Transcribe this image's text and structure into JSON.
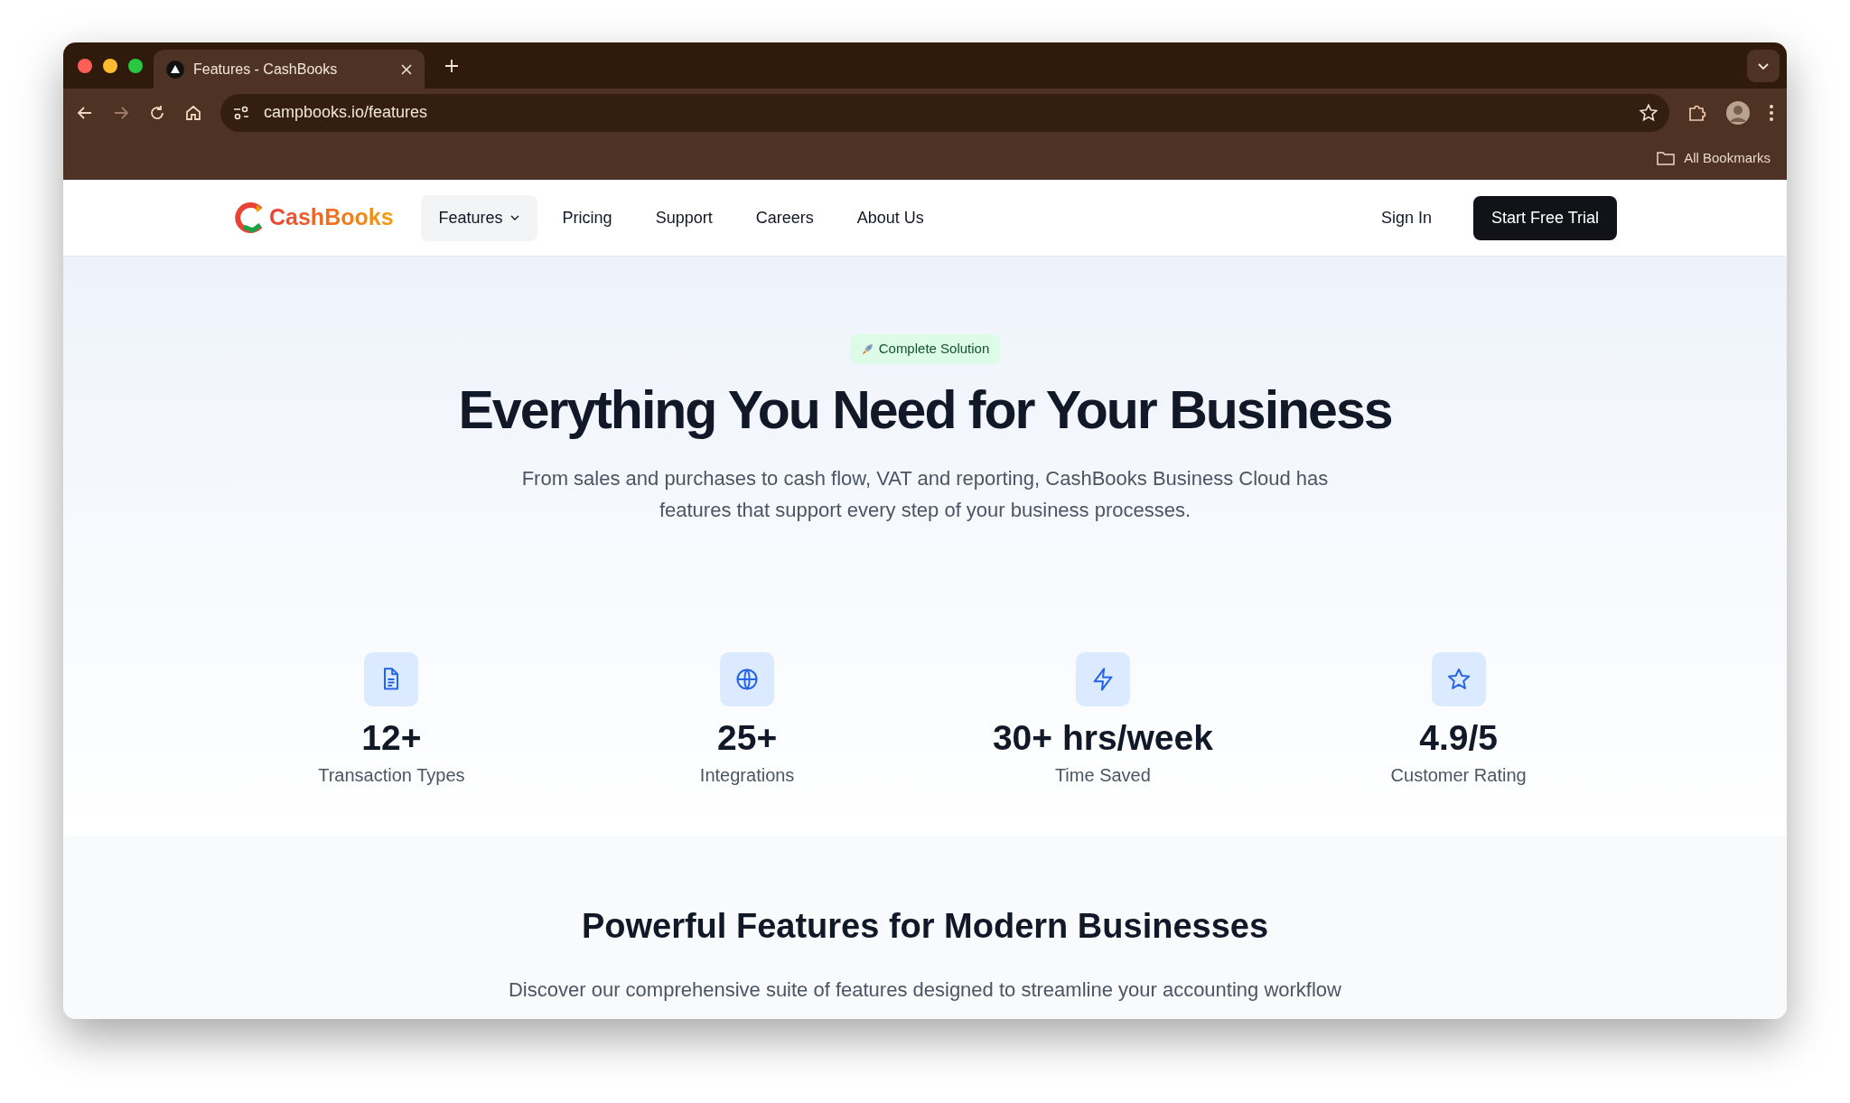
{
  "browser": {
    "tab_title": "Features - CashBooks",
    "address": "campbooks.io/features",
    "bookmarks_label": "All Bookmarks"
  },
  "navbar": {
    "logo_text": "CashBooks",
    "items": [
      {
        "label": "Features",
        "selected": true,
        "dropdown": true
      },
      {
        "label": "Pricing",
        "selected": false,
        "dropdown": false
      },
      {
        "label": "Support",
        "selected": false,
        "dropdown": false
      },
      {
        "label": "Careers",
        "selected": false,
        "dropdown": false
      },
      {
        "label": "About Us",
        "selected": false,
        "dropdown": false
      }
    ],
    "sign_in": "Sign In",
    "cta": "Start Free Trial"
  },
  "hero": {
    "badge": "Complete Solution",
    "title": "Everything You Need for Your Business",
    "subtitle": "From sales and purchases to cash flow, VAT and reporting, CashBooks Business Cloud has features that support every step of your business processes."
  },
  "stats": [
    {
      "kind": "document",
      "value": "12+",
      "label": "Transaction Types"
    },
    {
      "kind": "globe",
      "value": "25+",
      "label": "Integrations"
    },
    {
      "kind": "bolt",
      "value": "30+ hrs/week",
      "label": "Time Saved"
    },
    {
      "kind": "star",
      "value": "4.9/5",
      "label": "Customer Rating"
    }
  ],
  "features": {
    "heading": "Powerful Features for Modern Businesses",
    "description": "Discover our comprehensive suite of features designed to streamline your accounting workflow"
  }
}
